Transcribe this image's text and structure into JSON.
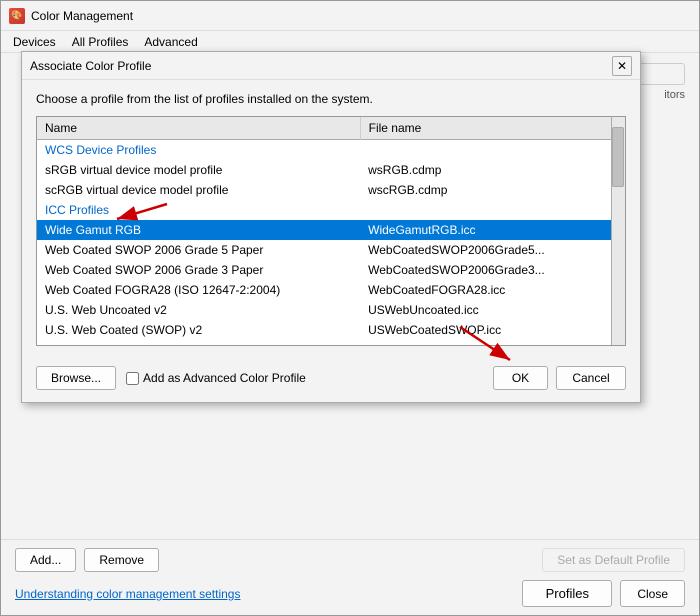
{
  "window": {
    "title": "Color Management",
    "icon": "🎨"
  },
  "menubar": {
    "items": [
      "Devices",
      "All Profiles",
      "Advanced"
    ]
  },
  "dialog": {
    "title": "Associate Color Profile",
    "description": "Choose a profile from the list of profiles installed on the system.",
    "columns": {
      "name": "Name",
      "filename": "File name"
    },
    "categories": [
      {
        "type": "category",
        "label": "WCS Device Profiles"
      },
      {
        "type": "row",
        "name": "sRGB virtual device model profile",
        "filename": "wsRGB.cdmp"
      },
      {
        "type": "row",
        "name": "scRGB virtual device model profile",
        "filename": "wscRGB.cdmp"
      },
      {
        "type": "category",
        "label": "ICC Profiles"
      },
      {
        "type": "row",
        "name": "Wide Gamut RGB",
        "filename": "WideGamutRGB.icc",
        "selected": true
      },
      {
        "type": "row",
        "name": "Web Coated SWOP 2006 Grade 5 Paper",
        "filename": "WebCoatedSWOP2006Grade5..."
      },
      {
        "type": "row",
        "name": "Web Coated SWOP 2006 Grade 3 Paper",
        "filename": "WebCoatedSWOP2006Grade3..."
      },
      {
        "type": "row",
        "name": "Web Coated FOGRA28 (ISO 12647-2:2004)",
        "filename": "WebCoatedFOGRA28.icc"
      },
      {
        "type": "row",
        "name": "U.S. Web Uncoated v2",
        "filename": "USWebUncoated.icc"
      },
      {
        "type": "row",
        "name": "U.S. Web Coated (SWOP) v2",
        "filename": "USWebCoatedSWOP.icc"
      }
    ],
    "buttons": {
      "browse": "Browse...",
      "ok": "OK",
      "cancel": "Cancel",
      "checkbox_label": "Add as Advanced Color Profile"
    }
  },
  "bottom": {
    "add": "Add...",
    "remove": "Remove",
    "set_default": "Set as Default Profile",
    "link": "Understanding color management settings",
    "profiles": "Profiles",
    "close": "Close"
  }
}
